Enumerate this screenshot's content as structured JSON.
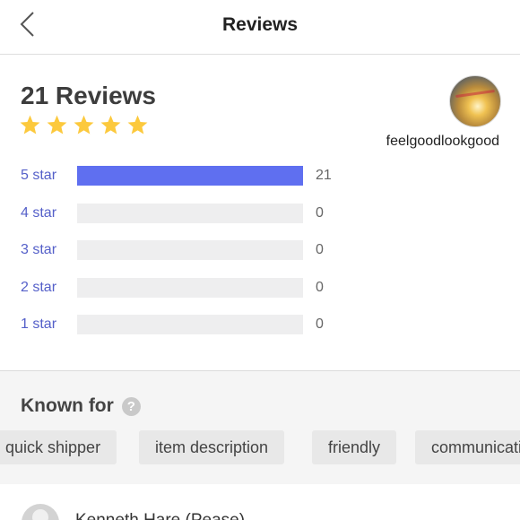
{
  "header": {
    "title": "Reviews",
    "back_icon": "chevron-left-icon"
  },
  "summary": {
    "count_title": "21 Reviews",
    "rating_stars": 5,
    "star_color": "#fcc93d",
    "username": "feelgoodlookgood"
  },
  "breakdown": [
    {
      "label": "5 star",
      "count": "21",
      "fraction": 1.0
    },
    {
      "label": "4 star",
      "count": "0",
      "fraction": 0
    },
    {
      "label": "3 star",
      "count": "0",
      "fraction": 0
    },
    {
      "label": "2 star",
      "count": "0",
      "fraction": 0
    },
    {
      "label": "1 star",
      "count": "0",
      "fraction": 0
    }
  ],
  "known_for": {
    "title": "Known for",
    "help_icon": "question-circle-icon",
    "help_glyph": "?",
    "tags": [
      "quick shipper",
      "item description",
      "friendly",
      "communication"
    ]
  },
  "review_preview": {
    "reviewer_name": "Kenneth Hare (Pease)"
  },
  "colors": {
    "accent": "#5f6ff0",
    "label": "#5560c9",
    "track": "#eeeeef"
  }
}
